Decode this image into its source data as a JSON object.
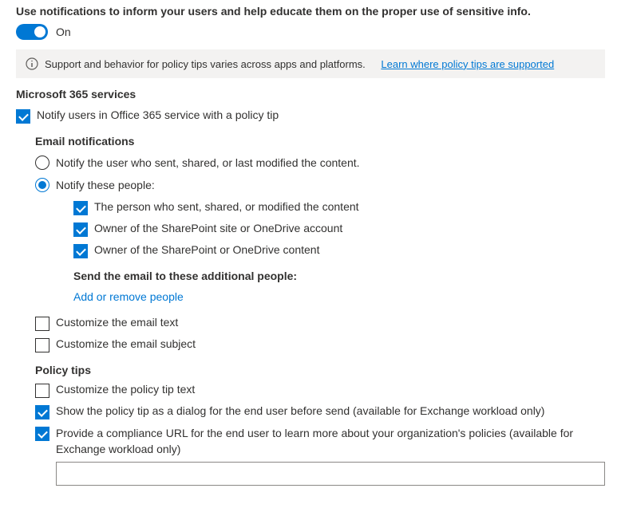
{
  "header": {
    "title": "Use notifications to inform your users and help educate them on the proper use of sensitive info.",
    "toggle_label": "On"
  },
  "infobar": {
    "text": "Support and behavior for policy tips varies across apps and platforms.",
    "link": "Learn where policy tips are supported"
  },
  "section_ms365": "Microsoft 365 services",
  "notify_office365": "Notify users in Office 365 service with a policy tip",
  "email_notifications": {
    "heading": "Email notifications",
    "radio_user": "Notify the user who sent, shared, or last modified the content.",
    "radio_people": "Notify these people:",
    "cb_person": "The person who sent, shared, or modified the content",
    "cb_site_owner": "Owner of the SharePoint site or OneDrive account",
    "cb_content_owner": "Owner of the SharePoint or OneDrive content",
    "additional_heading": "Send the email to these additional people:",
    "add_link": "Add or remove people",
    "cb_custom_text": "Customize the email text",
    "cb_custom_subject": "Customize the email subject"
  },
  "policy_tips": {
    "heading": "Policy tips",
    "cb_custom_tip": "Customize the policy tip text",
    "cb_dialog": "Show the policy tip as a dialog for the end user before send (available for Exchange workload only)",
    "cb_compliance_url": "Provide a compliance URL for the end user to learn more about your organization's policies (available for Exchange workload only)",
    "url_value": ""
  }
}
